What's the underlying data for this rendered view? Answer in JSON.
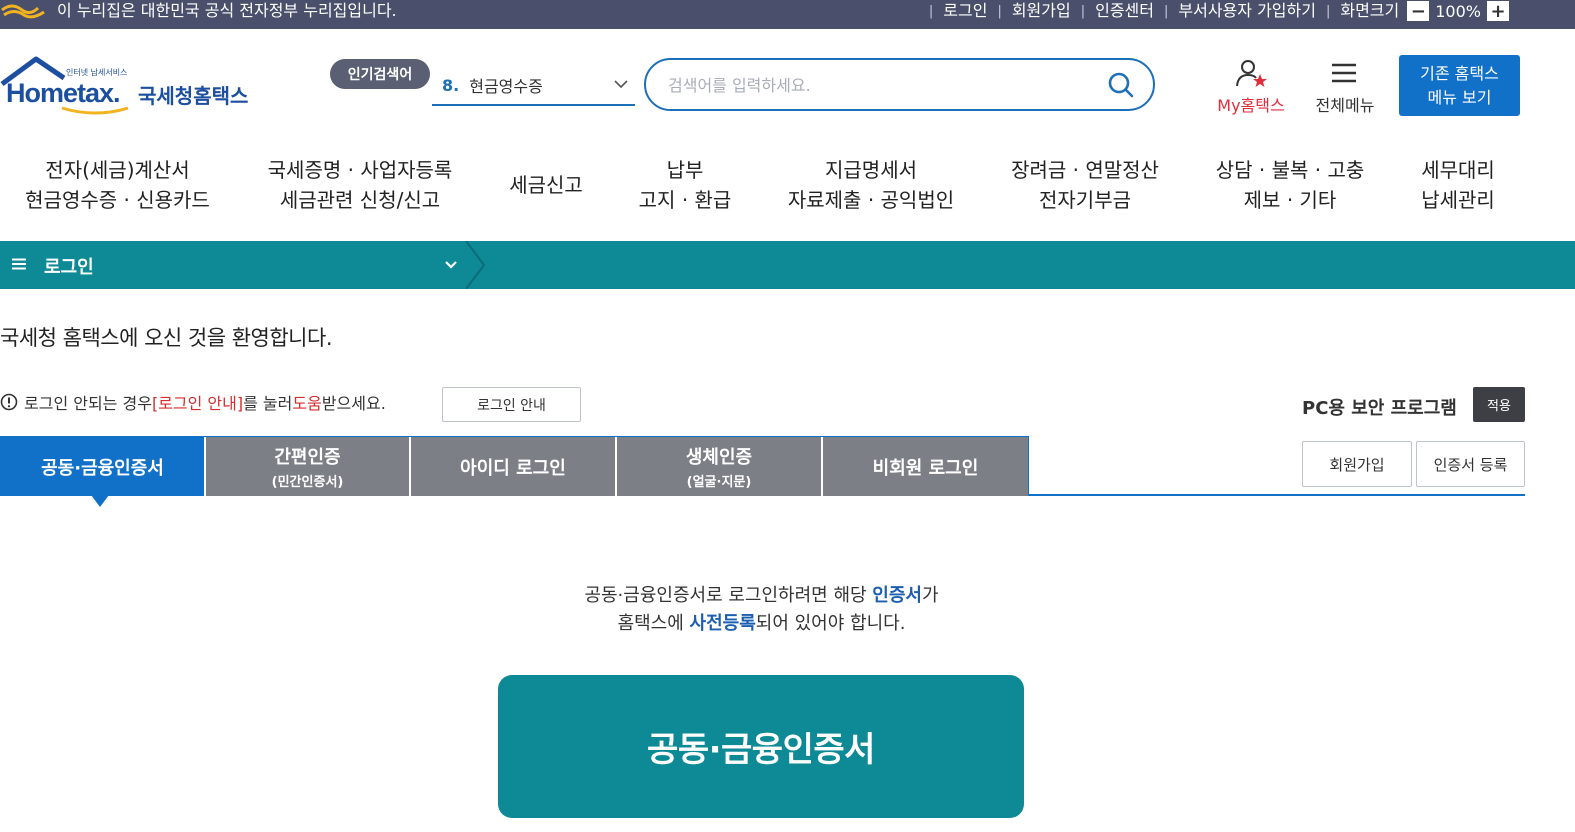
{
  "topbar": {
    "gov_notice": "이 누리집은 대한민국 공식 전자정부 누리집입니다.",
    "links": [
      "로그인",
      "회원가입",
      "인증센터",
      "부서사용자 가입하기",
      "화면크기"
    ],
    "zoom_minus": "−",
    "zoom_value": "100%",
    "zoom_plus": "+"
  },
  "logo": {
    "sub": "인터넷 납세서비스",
    "en": "Hometax.",
    "ko": "국세청홈택스"
  },
  "popular": {
    "badge": "인기검색어",
    "rank": "8.",
    "keyword": "현금영수증"
  },
  "search": {
    "placeholder": "검색어를 입력하세요."
  },
  "header": {
    "my_hometax": "My홈택스",
    "all_menu": "전체메뉴",
    "old_menu_line1": "기존 홈택스",
    "old_menu_line2": "메뉴 보기"
  },
  "nav": [
    {
      "line1": "전자(세금)계산서",
      "line2": "현금영수증 · 신용카드"
    },
    {
      "line1": "국세증명 · 사업자등록",
      "line2": "세금관련 신청/신고"
    },
    {
      "line1": "세금신고",
      "line2": ""
    },
    {
      "line1": "납부",
      "line2": "고지 · 환급"
    },
    {
      "line1": "지급명세서",
      "line2": "자료제출 · 공익법인"
    },
    {
      "line1": "장려금 · 연말정산",
      "line2": "전자기부금"
    },
    {
      "line1": "상담 · 불복 · 고충",
      "line2": "제보 · 기타"
    },
    {
      "line1": "세무대리",
      "line2": "납세관리"
    }
  ],
  "breadcrumb": {
    "title": "로그인"
  },
  "welcome": "국세청 홈택스에 오신 것을 환영합니다.",
  "help": {
    "part1": "로그인 안되는 경우 ",
    "link": "[로그인 안내]",
    "part2": "를 눌러 ",
    "help_word": "도움",
    "part3": "받으세요.",
    "button": "로그인 안내"
  },
  "security": {
    "label": "PC용 보안 프로그램",
    "apply": "적용"
  },
  "tabs": [
    {
      "label": "공동·금융인증서",
      "sub": ""
    },
    {
      "label": "간편인증",
      "sub": "(민간인증서)"
    },
    {
      "label": "아이디 로그인",
      "sub": ""
    },
    {
      "label": "생체인증",
      "sub": "(얼굴·지문)"
    },
    {
      "label": "비회원 로그인",
      "sub": ""
    }
  ],
  "side_buttons": {
    "signup": "회원가입",
    "cert_register": "인증서 등록"
  },
  "description": {
    "l1_a": "공동·금융인증서로 로그인하려면 해당 ",
    "l1_hl": "인증서",
    "l1_b": "가",
    "l2_a": "홈택스에 ",
    "l2_hl": "사전등록",
    "l2_b": "되어 있어야 합니다."
  },
  "main_button": "공동·금융인증서",
  "colors": {
    "teal": "#0e8a96",
    "blue": "#1171c8",
    "red": "#e02d3c"
  }
}
